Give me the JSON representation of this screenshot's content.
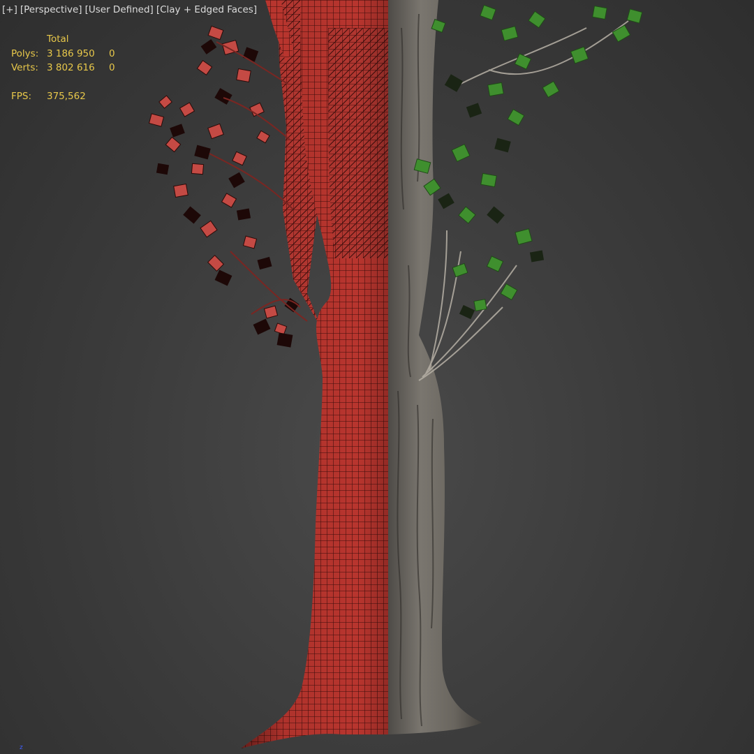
{
  "viewport": {
    "menus": [
      "[+]",
      "[Perspective]",
      "[User Defined]",
      "[Clay + Edged Faces]"
    ]
  },
  "stats": {
    "header": "Total",
    "rows": [
      {
        "label": "Polys:",
        "total": "3 186 950",
        "selected": "0"
      },
      {
        "label": "Verts:",
        "total": "3 802 616",
        "selected": "0"
      }
    ],
    "fps_label": "FPS:",
    "fps_value": "375,562"
  },
  "axis": {
    "label": "z"
  },
  "colors": {
    "background": "#3f3f3f",
    "wire_red": "#b8352e",
    "wire_lines": "#3a0d0b",
    "bark": "#6e6a64",
    "leaf_green": "#3f8f2e",
    "stats_yellow": "#e8c84a",
    "label_text": "#dcdcdc"
  },
  "icons": {
    "axis_gizmo": "axis-gizmo-icon"
  }
}
